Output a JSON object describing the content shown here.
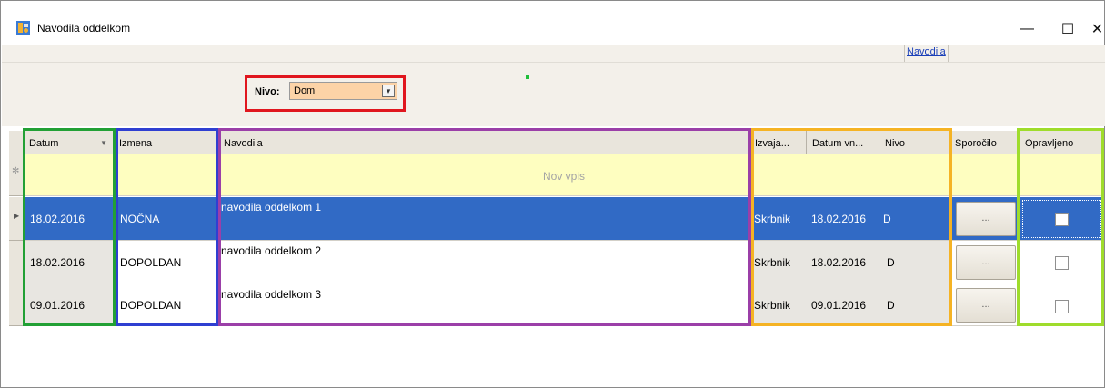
{
  "window": {
    "title": "Navodila oddelkom",
    "minimize_glyph": "—",
    "maximize_glyph": "☐",
    "close_glyph": "✕"
  },
  "menu": {
    "navodila_link": "Navodila"
  },
  "filter": {
    "label": "Nivo:",
    "value": "Dom",
    "dropdown_glyph": "▾"
  },
  "grid": {
    "columns": [
      "Datum",
      "Izmena",
      "Navodila",
      "Izvaja...",
      "Datum vn...",
      "Nivo",
      "Sporočilo",
      "Opravljeno"
    ],
    "new_row_text": "Nov vpis",
    "rows": [
      {
        "datum": "18.02.2016",
        "izmena": "NOČNA",
        "navodila": "navodila oddelkom 1",
        "izvaja": "Skrbnik",
        "datum_vn": "18.02.2016",
        "nivo": "D",
        "sporocilo": "...",
        "opravljeno": false
      },
      {
        "datum": "18.02.2016",
        "izmena": "DOPOLDAN",
        "navodila": "navodila oddelkom 2",
        "izvaja": "Skrbnik",
        "datum_vn": "18.02.2016",
        "nivo": "D",
        "sporocilo": "...",
        "opravljeno": false
      },
      {
        "datum": "09.01.2016",
        "izmena": "DOPOLDAN",
        "navodila": "navodila oddelkom 3",
        "izvaja": "Skrbnik",
        "datum_vn": "09.01.2016",
        "nivo": "D",
        "sporocilo": "...",
        "opravljeno": false
      }
    ]
  },
  "colors": {
    "selected_row": "#316ac5",
    "new_row": "#fefec0",
    "filter_field": "#fcd3a7",
    "outline_red": "#e0161e",
    "outline_green": "#22a035",
    "outline_blue": "#2f3fd1",
    "outline_purple": "#9b3fa8",
    "outline_orange": "#f5b324",
    "outline_lime": "#9fdc2c"
  }
}
